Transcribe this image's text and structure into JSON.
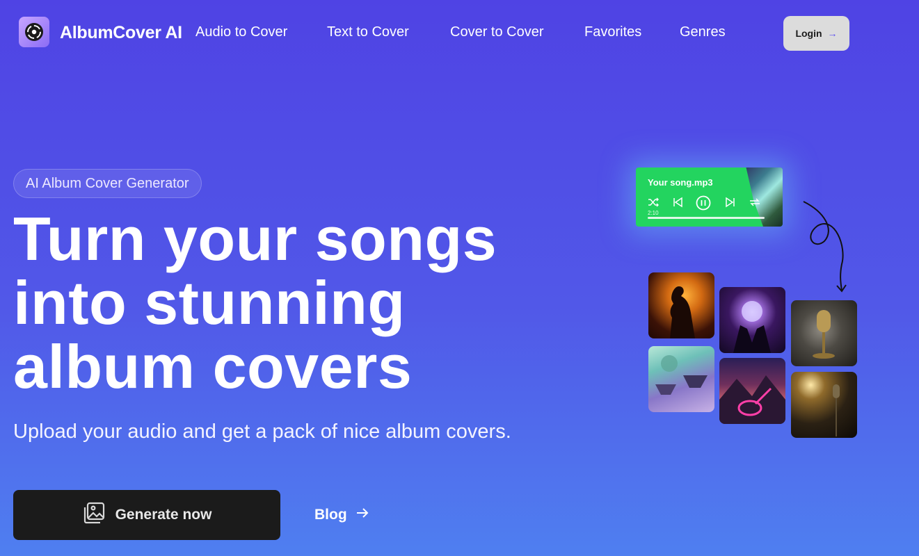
{
  "app": {
    "brand": "AlbumCover AI"
  },
  "nav": {
    "items": [
      "Audio to Cover",
      "Text to Cover",
      "Cover to Cover",
      "Favorites",
      "Genres"
    ],
    "login_label": "Login",
    "login_arrow": "→"
  },
  "hero": {
    "badge": "AI Album Cover Generator",
    "headline_lines": [
      "Turn your songs",
      "into stunning",
      "album covers"
    ],
    "subtitle": "Upload your audio and get a pack of nice album covers.",
    "cta_label": "Generate now",
    "blog_label": "Blog"
  },
  "player": {
    "song": "Your song.mp3",
    "time": "2:10"
  },
  "colors": {
    "accent": "#4f43e4",
    "player_green": "#23d45f",
    "button_dark": "#1b1b1b"
  }
}
